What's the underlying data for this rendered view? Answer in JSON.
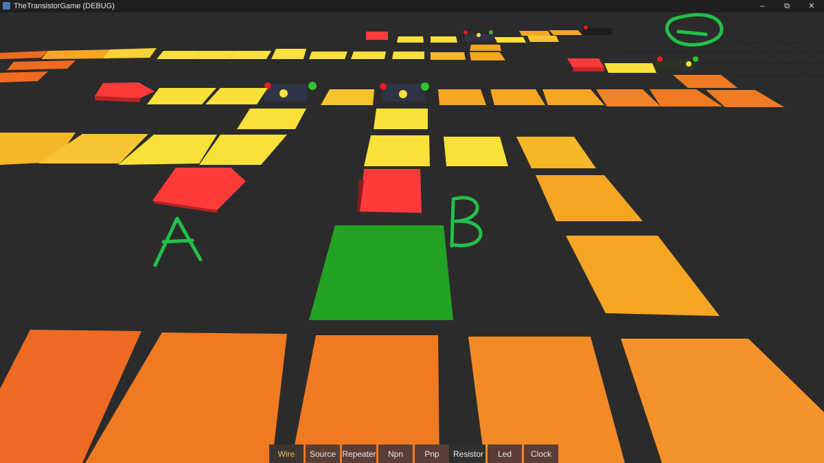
{
  "window": {
    "title": "TheTransistorGame (DEBUG)",
    "minimize_icon": "minimize-icon",
    "maximize_icon": "restore-icon",
    "close_icon": "close-icon"
  },
  "annotations": {
    "a": "A",
    "b": "B"
  },
  "toolbar": {
    "selected": "Wire",
    "items": [
      "Wire",
      "Source",
      "Repeater",
      "Npn",
      "Pnp",
      "Resistor",
      "Led",
      "Clock"
    ]
  },
  "colors": {
    "background": "#2b2b2b",
    "wire_hot": "#f7e13a",
    "wire_warm": "#f6a623",
    "wire_orange": "#f07a22",
    "source_red": "#ff3a3a",
    "led_green": "#23a323",
    "annotation_green": "#22c04a",
    "accent_selected": "#f2c14e"
  }
}
